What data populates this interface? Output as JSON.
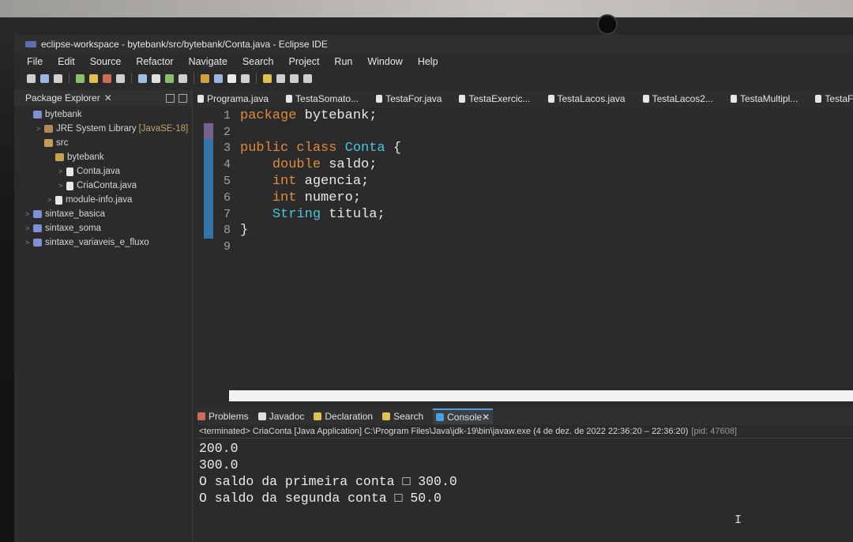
{
  "window": {
    "title": "eclipse-workspace - bytebank/src/bytebank/Conta.java - Eclipse IDE"
  },
  "menu": [
    "File",
    "Edit",
    "Source",
    "Refactor",
    "Navigate",
    "Search",
    "Project",
    "Run",
    "Window",
    "Help"
  ],
  "package_explorer": {
    "title": "Package Explorer",
    "close": "✕",
    "tree": [
      {
        "label": "bytebank",
        "indent": 0,
        "icon": "project-icon",
        "arrow": ""
      },
      {
        "label": "JRE System Library",
        "tag": "[JavaSE-18]",
        "indent": 1,
        "icon": "library-icon",
        "arrow": ">"
      },
      {
        "label": "src",
        "indent": 1,
        "icon": "source-folder-icon",
        "arrow": ""
      },
      {
        "label": "bytebank",
        "indent": 2,
        "icon": "package-icon",
        "arrow": ""
      },
      {
        "label": "Conta.java",
        "indent": 3,
        "icon": "java-file-icon",
        "arrow": ">"
      },
      {
        "label": "CriaConta.java",
        "indent": 3,
        "icon": "java-file-icon",
        "arrow": ">"
      },
      {
        "label": "module-info.java",
        "indent": 2,
        "icon": "java-file-icon",
        "arrow": ">"
      },
      {
        "label": "sintaxe_basica",
        "indent": 0,
        "icon": "project-icon",
        "arrow": ">"
      },
      {
        "label": "sintaxe_soma",
        "indent": 0,
        "icon": "project-icon",
        "arrow": ">"
      },
      {
        "label": "sintaxe_variaveis_e_fluxo",
        "indent": 0,
        "icon": "project-icon",
        "arrow": ">"
      }
    ]
  },
  "editor_tabs": [
    "Programa.java",
    "TestaSomato...",
    "TestaFor.java",
    "TestaExercic...",
    "TestaLacos.java",
    "TestaLacos2...",
    "TestaMultipl...",
    "TestaFa"
  ],
  "code_lines": [
    {
      "n": "1",
      "html": [
        [
          "kw",
          "package "
        ],
        [
          "id",
          "bytebank;"
        ]
      ]
    },
    {
      "n": "2",
      "html": []
    },
    {
      "n": "3",
      "html": [
        [
          "kw",
          "public class "
        ],
        [
          "ty",
          "Conta "
        ],
        [
          "id",
          "{"
        ]
      ]
    },
    {
      "n": "4",
      "html": [
        [
          "id",
          "    "
        ],
        [
          "kw",
          "double "
        ],
        [
          "id",
          "saldo;"
        ]
      ]
    },
    {
      "n": "5",
      "html": [
        [
          "id",
          "    "
        ],
        [
          "kw",
          "int "
        ],
        [
          "id",
          "agencia;"
        ]
      ]
    },
    {
      "n": "6",
      "html": [
        [
          "id",
          "    "
        ],
        [
          "kw",
          "int "
        ],
        [
          "id",
          "numero;"
        ]
      ]
    },
    {
      "n": "7",
      "html": [
        [
          "id",
          "    "
        ],
        [
          "ty",
          "String "
        ],
        [
          "id",
          "titula;"
        ]
      ]
    },
    {
      "n": "8",
      "html": [
        [
          "id",
          "}"
        ]
      ]
    },
    {
      "n": "9",
      "html": []
    }
  ],
  "bottom_tabs": [
    {
      "label": "Problems",
      "icon": "problems-icon"
    },
    {
      "label": "Javadoc",
      "icon": "javadoc-icon"
    },
    {
      "label": "Declaration",
      "icon": "declaration-icon"
    },
    {
      "label": "Search",
      "icon": "search-icon"
    },
    {
      "label": "Console",
      "icon": "console-icon",
      "active": true,
      "close": "✕"
    }
  ],
  "console": {
    "terminated": "<terminated> CriaConta [Java Application] C:\\Program Files\\Java\\jdk-19\\bin\\javaw.exe  (4 de dez. de 2022 22:36:20 – 22:36:20)",
    "pid": "[pid: 47608]",
    "output": [
      "200.0",
      "300.0",
      "O saldo da primeira conta □ 300.0",
      "O saldo da segunda conta □ 50.0"
    ]
  },
  "colors": {
    "keyword": "#e08a3a",
    "type": "#48c6e0",
    "background": "#2b2b2b"
  }
}
